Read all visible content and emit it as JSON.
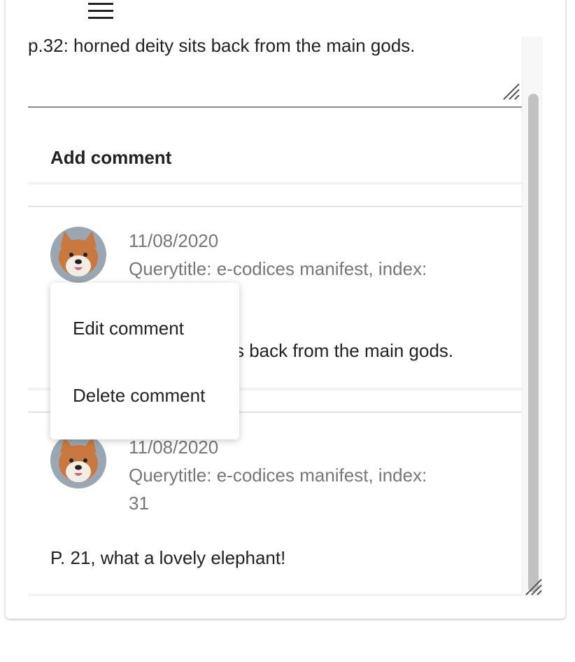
{
  "toolbar": {
    "menu_icon": "hamburger-menu-icon"
  },
  "note": {
    "text": "p.32: horned deity sits back from the main gods."
  },
  "add_comment_label": "Add comment",
  "comments": [
    {
      "date": "11/08/2020",
      "meta_line1": "Querytitle: e-codices manifest, index:",
      "body_visible_fragment": "s back from the main gods."
    },
    {
      "date": "11/08/2020",
      "meta_line1": "Querytitle: e-codices manifest, index:",
      "meta_line2": "31",
      "body": "P. 21, what a lovely elephant!"
    }
  ],
  "context_menu": {
    "edit": "Edit comment",
    "delete": "Delete comment"
  },
  "colors": {
    "avatar_fur": "#c9783f",
    "scroll_thumb": "#c1c1c1"
  }
}
